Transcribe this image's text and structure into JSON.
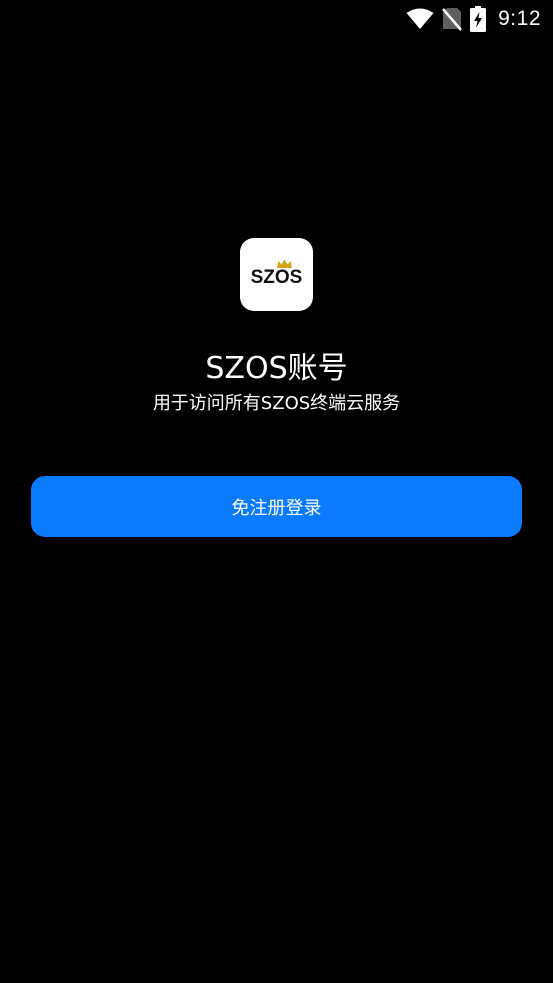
{
  "status_bar": {
    "time": "9:12",
    "icons": [
      "wifi-icon",
      "no-sim-icon",
      "battery-charging-icon"
    ]
  },
  "app": {
    "logo_text": "SZOS",
    "logo_icon": "crown-icon",
    "title": "SZOS账号",
    "subtitle": "用于访问所有SZOS终端云服务"
  },
  "actions": {
    "login_label": "免注册登录"
  },
  "colors": {
    "background": "#000000",
    "primary_button": "#0a7aff",
    "text": "#ffffff",
    "logo_crown": "#d4a21c"
  }
}
